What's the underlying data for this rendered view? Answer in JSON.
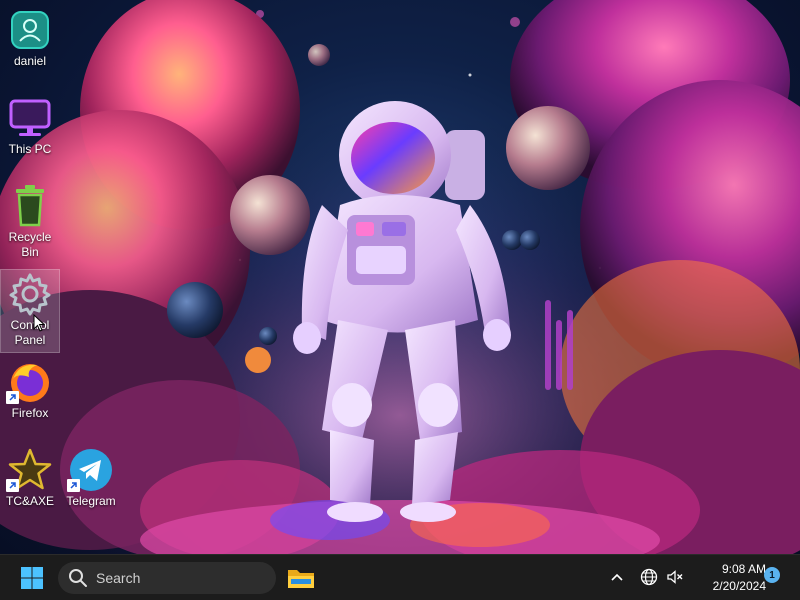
{
  "desktop": {
    "icons": [
      {
        "label": "daniel",
        "icon": "user-folder-icon"
      },
      {
        "label": "This PC",
        "icon": "monitor-icon"
      },
      {
        "label": "Recycle Bin",
        "icon": "recycle-bin-icon"
      },
      {
        "label": "Control Panel",
        "icon": "gear-icon"
      },
      {
        "label": "Firefox",
        "icon": "firefox-icon"
      },
      {
        "label": "TC&AXE",
        "icon": "star-icon"
      },
      {
        "label": "Telegram",
        "icon": "telegram-icon"
      }
    ]
  },
  "taskbar": {
    "search_placeholder": "Search",
    "pinned_app": "file-explorer-icon",
    "clock": {
      "time": "9:08 AM",
      "date": "2/20/2024"
    },
    "notification_count": "1"
  },
  "colors": {
    "taskbar": "#1c1c1c",
    "accent": "#5ab3f0"
  }
}
